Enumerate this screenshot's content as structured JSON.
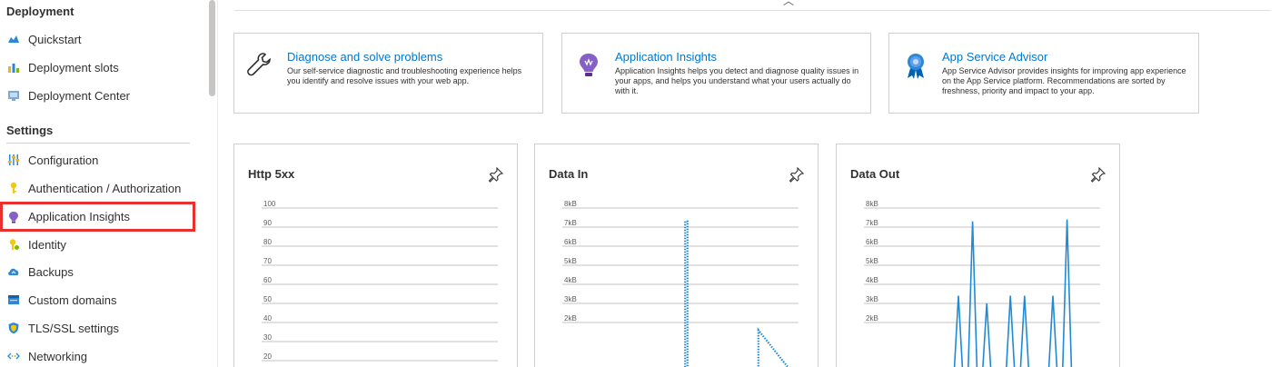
{
  "sidebar": {
    "sections": [
      {
        "title": "Deployment",
        "items": [
          {
            "label": "Quickstart",
            "icon": "quickstart-icon"
          },
          {
            "label": "Deployment slots",
            "icon": "deployment-slots-icon"
          },
          {
            "label": "Deployment Center",
            "icon": "deployment-center-icon"
          }
        ]
      },
      {
        "title": "Settings",
        "items": [
          {
            "label": "Configuration",
            "icon": "configuration-icon"
          },
          {
            "label": "Authentication / Authorization",
            "icon": "key-icon"
          },
          {
            "label": "Application Insights",
            "icon": "lightbulb-icon",
            "highlighted": true
          },
          {
            "label": "Identity",
            "icon": "identity-key-icon"
          },
          {
            "label": "Backups",
            "icon": "cloud-backup-icon"
          },
          {
            "label": "Custom domains",
            "icon": "domain-icon"
          },
          {
            "label": "TLS/SSL settings",
            "icon": "shield-icon"
          },
          {
            "label": "Networking",
            "icon": "networking-icon"
          }
        ]
      }
    ]
  },
  "cards": [
    {
      "title": "Diagnose and solve problems",
      "description": "Our self-service diagnostic and troubleshooting experience helps you identify and resolve issues with your web app.",
      "icon": "wrench-icon"
    },
    {
      "title": "Application Insights",
      "description": "Application Insights helps you detect and diagnose quality issues in your apps, and helps you understand what your users actually do with it.",
      "icon": "lightbulb-icon"
    },
    {
      "title": "App Service Advisor",
      "description": "App Service Advisor provides insights for improving app experience on the App Service platform. Recommendations are sorted by freshness, priority and impact to your app.",
      "icon": "advisor-badge-icon"
    }
  ],
  "colors": {
    "accent": "#0078d4",
    "highlight": "#e8312f",
    "series": "#1f8ad6"
  },
  "chart_data": [
    {
      "type": "line",
      "title": "Http 5xx",
      "y_ticks": [
        "100",
        "90",
        "80",
        "70",
        "60",
        "50",
        "40",
        "30",
        "20"
      ],
      "ylim": [
        20,
        100
      ],
      "series": []
    },
    {
      "type": "line",
      "title": "Data In",
      "y_ticks": [
        "8kB",
        "7kB",
        "6kB",
        "5kB",
        "4kB",
        "3kB",
        "2kB"
      ],
      "ylim": [
        2,
        8
      ],
      "series": [
        {
          "style": "dotted",
          "x": [
            0.0,
            0.52,
            0.52,
            0.53,
            0.53,
            0.83,
            0.83,
            1.0
          ],
          "values": [
            0,
            0,
            7.3,
            7.3,
            0,
            0,
            1.6,
            0
          ]
        }
      ]
    },
    {
      "type": "line",
      "title": "Data Out",
      "y_ticks": [
        "8kB",
        "7kB",
        "6kB",
        "5kB",
        "4kB",
        "3kB",
        "2kB"
      ],
      "ylim": [
        2,
        8
      ],
      "series": [
        {
          "style": "solid",
          "x": [
            0.0,
            0.38,
            0.4,
            0.42,
            0.44,
            0.46,
            0.48,
            0.5,
            0.52,
            0.54,
            0.56,
            0.58,
            0.6,
            0.62,
            0.64,
            0.66,
            0.68,
            0.7,
            0.72,
            0.74,
            0.76,
            0.78,
            0.8,
            0.82,
            0.84,
            0.86,
            0.88,
            0.9,
            0.92
          ],
          "values": [
            0,
            0,
            3.4,
            0,
            0,
            7.3,
            0,
            0,
            3.0,
            0,
            0,
            0,
            0,
            3.4,
            0,
            0,
            3.4,
            0,
            0,
            0,
            0,
            0,
            3.4,
            0,
            0,
            7.4,
            0,
            0,
            0
          ]
        }
      ]
    }
  ]
}
